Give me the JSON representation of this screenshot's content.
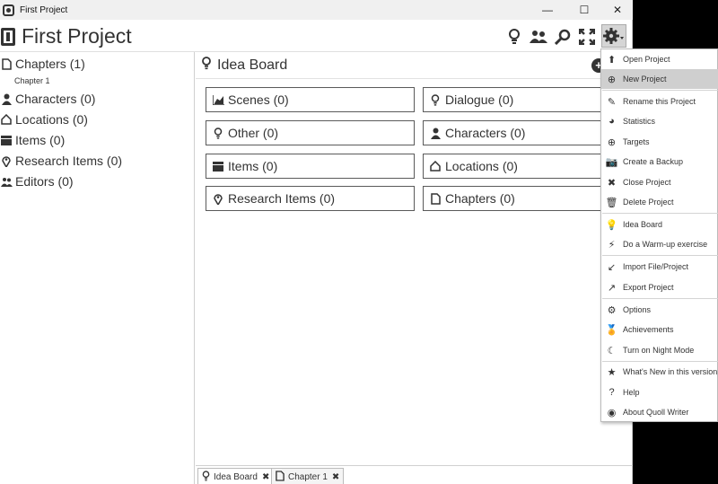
{
  "window": {
    "title": "First Project",
    "minimize_glyph": "—",
    "maximize_glyph": "☐",
    "close_glyph": "✕"
  },
  "header": {
    "project_title": "First Project",
    "icons": [
      "lightbulb-icon",
      "people-icon",
      "search-icon",
      "fullscreen-icon",
      "gear-icon"
    ]
  },
  "sidebar": {
    "items": [
      {
        "icon": "document-icon",
        "glyph": "🗋",
        "label": "Chapters (1)"
      },
      {
        "icon": "person-icon",
        "glyph": "👤",
        "label": "Characters (0)"
      },
      {
        "icon": "home-icon",
        "glyph": "⌂",
        "label": "Locations (0)"
      },
      {
        "icon": "items-icon",
        "glyph": "▆",
        "label": "Items (0)"
      },
      {
        "icon": "pin-icon",
        "glyph": "♥",
        "label": "Research Items (0)"
      },
      {
        "icon": "people-icon",
        "glyph": "👥",
        "label": "Editors (0)"
      }
    ],
    "chapter_sub": "Chapter 1"
  },
  "board": {
    "title": "Idea Board",
    "add_glyph": "+",
    "categories": [
      {
        "icon": "chart-icon",
        "glyph": "📈",
        "label": "Scenes (0)"
      },
      {
        "icon": "lightbulb-icon",
        "glyph": "💡",
        "label": "Dialogue (0)"
      },
      {
        "icon": "lightbulb-icon",
        "glyph": "💡",
        "label": "Other (0)"
      },
      {
        "icon": "person-icon",
        "glyph": "👤",
        "label": "Characters (0)"
      },
      {
        "icon": "items-icon",
        "glyph": "▆",
        "label": "Items (0)"
      },
      {
        "icon": "home-icon",
        "glyph": "⌂",
        "label": "Locations (0)"
      },
      {
        "icon": "pin-icon",
        "glyph": "♥",
        "label": "Research Items (0)"
      },
      {
        "icon": "document-icon",
        "glyph": "🗋",
        "label": "Chapters (0)"
      }
    ]
  },
  "tabs": [
    {
      "icon": "lightbulb-icon",
      "glyph": "💡",
      "label": "Idea Board",
      "close": "✖"
    },
    {
      "icon": "document-icon",
      "glyph": "🗋",
      "label": "Chapter 1",
      "close": "✖"
    }
  ],
  "menu": {
    "items": [
      {
        "icon": "arrow-up-icon",
        "glyph": "⬆",
        "label": "Open Project"
      },
      {
        "icon": "plus-circle-icon",
        "glyph": "⊕",
        "label": "New Project",
        "highlighted": true
      },
      {
        "icon": "pencil-icon",
        "glyph": "✎",
        "label": "Rename this Project"
      },
      {
        "icon": "pie-chart-icon",
        "glyph": "◕",
        "label": "Statistics"
      },
      {
        "icon": "target-icon",
        "glyph": "⊕",
        "label": "Targets"
      },
      {
        "icon": "camera-icon",
        "glyph": "📷",
        "label": "Create a Backup"
      },
      {
        "icon": "x-icon",
        "glyph": "✖",
        "label": "Close Project"
      },
      {
        "icon": "trash-icon",
        "glyph": "🗑",
        "label": "Delete Project"
      },
      {
        "icon": "lightbulb-icon",
        "glyph": "💡",
        "label": "Idea Board"
      },
      {
        "icon": "lightning-icon",
        "glyph": "⚡",
        "label": "Do a Warm-up exercise"
      },
      {
        "icon": "arrow-down-left-icon",
        "glyph": "↙",
        "label": "Import File/Project"
      },
      {
        "icon": "arrow-up-right-icon",
        "glyph": "↗",
        "label": "Export Project"
      },
      {
        "icon": "gear-icon",
        "glyph": "⚙",
        "label": "Options"
      },
      {
        "icon": "award-icon",
        "glyph": "🏅",
        "label": "Achievements"
      },
      {
        "icon": "moon-icon",
        "glyph": "☾",
        "label": "Turn on Night Mode"
      },
      {
        "icon": "star-icon",
        "glyph": "★",
        "label": "What's New in this version"
      },
      {
        "icon": "question-icon",
        "glyph": "?",
        "label": "Help"
      },
      {
        "icon": "quoll-icon",
        "glyph": "◉",
        "label": "About Quoll Writer"
      }
    ]
  }
}
